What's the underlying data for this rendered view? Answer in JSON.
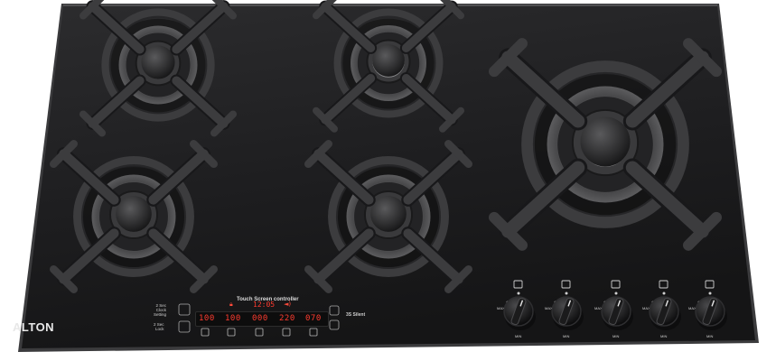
{
  "brand": "ALTON",
  "panel": {
    "title": "Touch Screen controller",
    "clock_label": "2 Sec\nClock\nSetting",
    "lock_label": "2 Sec\nLock",
    "silent_label": "3S Silent",
    "top_time": "12:05",
    "readings": [
      "100",
      "100",
      "000",
      "220",
      "070"
    ]
  },
  "colors": {
    "glass": "#1f1f21",
    "glass_edge": "#3a3a3c",
    "cast_iron": "#3c3c3e",
    "burner_ring": "#555557",
    "display_red": "#ff3b2f"
  },
  "knobs": {
    "count": 5,
    "labels": {
      "max": "MAX",
      "min": "MIN"
    }
  },
  "icons": [
    "timer-icon",
    "lock-icon",
    "bell-icon",
    "up-icon",
    "down-icon",
    "flame-icon"
  ]
}
